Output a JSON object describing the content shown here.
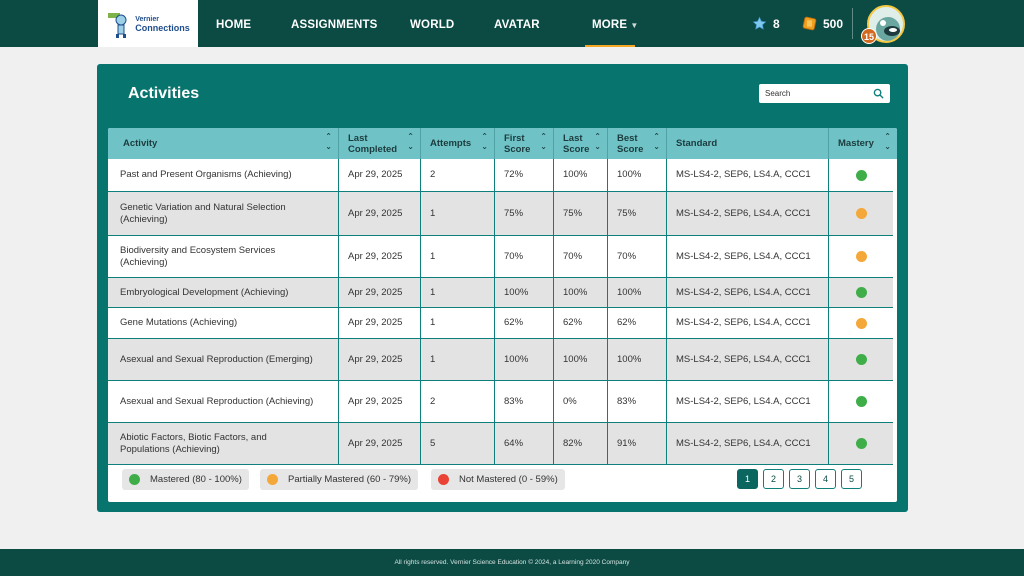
{
  "nav": {
    "logo_line1": "Vernier",
    "logo_line2": "Connections",
    "items": [
      {
        "label": "HOME"
      },
      {
        "label": "ASSIGNMENTS"
      },
      {
        "label": "WORLD"
      },
      {
        "label": "AVATAR"
      },
      {
        "label": "MORE"
      }
    ],
    "stars": "8",
    "coins": "500",
    "level": "15"
  },
  "activities": {
    "title": "Activities",
    "search_placeholder": "Search",
    "columns": [
      "Activity",
      "Last Completed",
      "Attempts",
      "First Score",
      "Last Score",
      "Best Score",
      "Standard",
      "Mastery"
    ],
    "rows": [
      {
        "activity": "Past and Present Organisms (Achieving)",
        "last_completed": "Apr 29, 2025",
        "attempts": "2",
        "first": "72%",
        "last": "100%",
        "best": "100%",
        "standard": "MS-LS4-2, SEP6, LS4.A, CCC1",
        "mastery": "green"
      },
      {
        "activity": "Genetic Variation and Natural Selection (Achieving)",
        "last_completed": "Apr 29, 2025",
        "attempts": "1",
        "first": "75%",
        "last": "75%",
        "best": "75%",
        "standard": "MS-LS4-2, SEP6, LS4.A, CCC1",
        "mastery": "orange"
      },
      {
        "activity": "Biodiversity and Ecosystem Services (Achieving)",
        "last_completed": "Apr 29, 2025",
        "attempts": "1",
        "first": "70%",
        "last": "70%",
        "best": "70%",
        "standard": "MS-LS4-2, SEP6, LS4.A, CCC1",
        "mastery": "orange"
      },
      {
        "activity": "Embryological Development (Achieving)",
        "last_completed": "Apr 29, 2025",
        "attempts": "1",
        "first": "100%",
        "last": "100%",
        "best": "100%",
        "standard": "MS-LS4-2, SEP6, LS4.A, CCC1",
        "mastery": "green"
      },
      {
        "activity": "Gene Mutations (Achieving)",
        "last_completed": "Apr 29, 2025",
        "attempts": "1",
        "first": "62%",
        "last": "62%",
        "best": "62%",
        "standard": "MS-LS4-2, SEP6, LS4.A, CCC1",
        "mastery": "orange"
      },
      {
        "activity": "Asexual and Sexual Reproduction (Emerging)",
        "last_completed": "Apr 29, 2025",
        "attempts": "1",
        "first": "100%",
        "last": "100%",
        "best": "100%",
        "standard": "MS-LS4-2, SEP6, LS4.A, CCC1",
        "mastery": "green"
      },
      {
        "activity": "Asexual and Sexual Reproduction (Achieving)",
        "last_completed": "Apr 29, 2025",
        "attempts": "2",
        "first": "83%",
        "last": "0%",
        "best": "83%",
        "standard": "MS-LS4-2, SEP6, LS4.A, CCC1",
        "mastery": "green"
      },
      {
        "activity": "Abiotic Factors, Biotic Factors, and Populations (Achieving)",
        "last_completed": "Apr 29, 2025",
        "attempts": "5",
        "first": "64%",
        "last": "82%",
        "best": "91%",
        "standard": "MS-LS4-2, SEP6, LS4.A, CCC1",
        "mastery": "green"
      }
    ],
    "legend": [
      {
        "label": "Mastered (80 - 100%)",
        "color": "#3fae49"
      },
      {
        "label": "Partially Mastered (60 - 79%)",
        "color": "#f4a83a"
      },
      {
        "label": "Not Mastered (0 - 59%)",
        "color": "#ea4335"
      }
    ],
    "pages": [
      "1",
      "2",
      "3",
      "4",
      "5"
    ],
    "current_page": "1"
  },
  "colors": {
    "green": "#3fae49",
    "orange": "#f4a83a",
    "red": "#ea4335",
    "brand": "#0c4b44",
    "panel": "#08746e"
  },
  "footer": {
    "text": "All rights reserved. Vernier Science Education © 2024, a Learning 2020 Company"
  }
}
